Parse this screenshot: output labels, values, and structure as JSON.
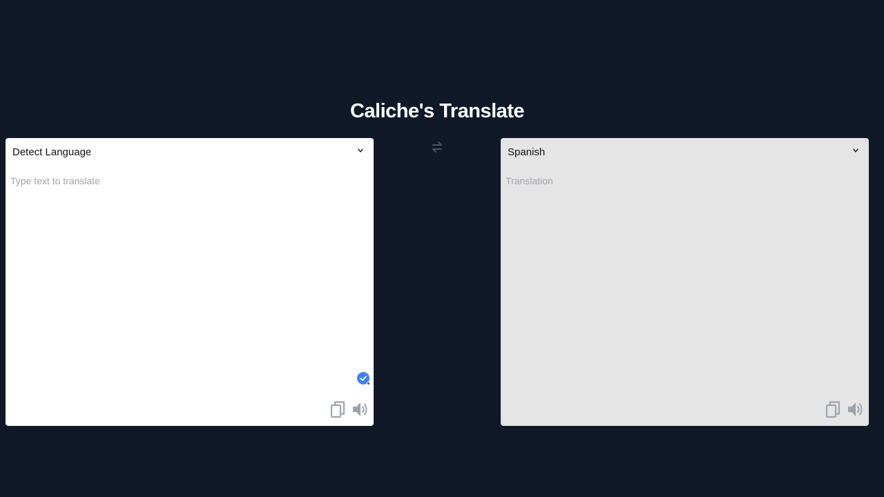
{
  "app": {
    "title": "Caliche's Translate"
  },
  "source": {
    "language": "Detect Language",
    "placeholder": "Type text to translate",
    "value": ""
  },
  "target": {
    "language": "Spanish",
    "placeholder": "Translation",
    "value": ""
  },
  "icons": {
    "swap": "swap-arrows-icon",
    "chevron": "chevron-down-icon",
    "copy": "copy-icon",
    "speaker": "speaker-icon",
    "check": "check-badge-icon"
  },
  "colors": {
    "background": "#111827",
    "source_panel": "#ffffff",
    "target_panel": "#e5e5e5",
    "icon_gray": "#9ca3af",
    "accent_blue": "#3b82f6"
  }
}
